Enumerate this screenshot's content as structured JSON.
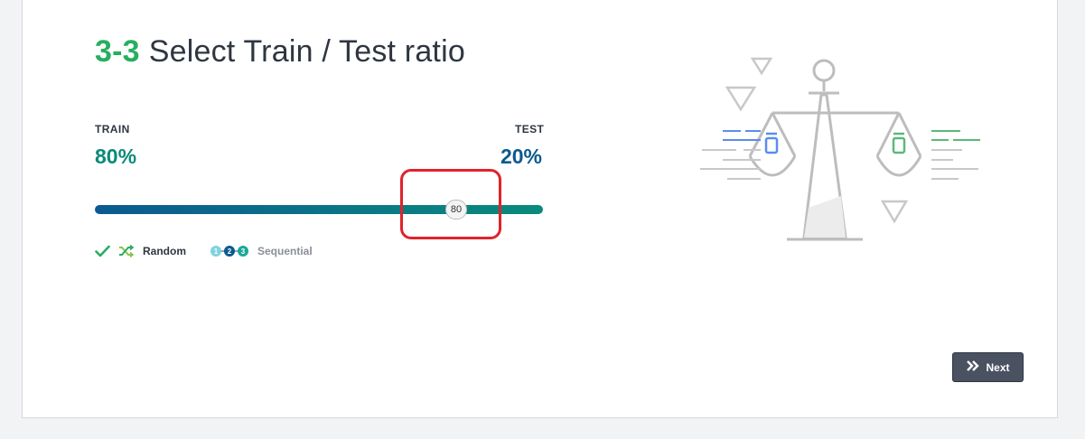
{
  "header": {
    "step": "3-3",
    "title": "Select Train / Test ratio"
  },
  "split": {
    "train_label": "TRAIN",
    "test_label": "TEST",
    "train_value": "80%",
    "test_value": "20%",
    "slider_value": "80"
  },
  "options": {
    "random_label": "Random",
    "sequential_label": "Sequential",
    "selected": "random"
  },
  "footer": {
    "next_label": "Next"
  },
  "colors": {
    "accent_green": "#27ae60",
    "train_color": "#0a8a7b",
    "test_color": "#0b5a8f",
    "highlight": "#e0232b"
  },
  "icons": [
    "check-icon",
    "shuffle-icon",
    "sequence-icon",
    "chevron-double-right-icon",
    "balance-scale-illustration"
  ]
}
